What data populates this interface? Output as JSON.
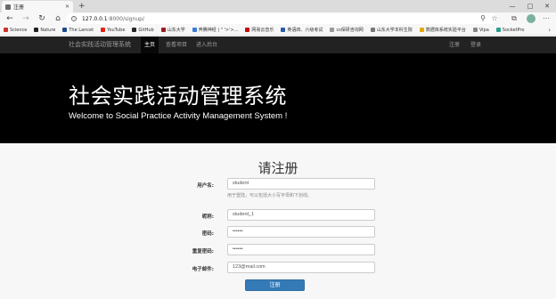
{
  "browser": {
    "tab_title": "注册",
    "tab_close": "✕",
    "new_tab": "+",
    "window_controls": {
      "minimize": "—",
      "maximize": "□",
      "close": "✕"
    },
    "nav_icons": {
      "back": "←",
      "forward": "→",
      "refresh": "↻",
      "home": "⌂"
    },
    "url": {
      "host": "127.0.0.1",
      "path": ":8000/signup/"
    },
    "toolbar_icons": {
      "extensions": "⚲",
      "favorite": "☆",
      "collections": "⧉",
      "more": "⋯"
    },
    "bookmarks": [
      {
        "label": "Science",
        "color": "#d0312d"
      },
      {
        "label": "Nature",
        "color": "#222222"
      },
      {
        "label": "The Lancet",
        "color": "#1a4a8a"
      },
      {
        "label": "YouTube",
        "color": "#e62117"
      },
      {
        "label": "GitHub",
        "color": "#24292e"
      },
      {
        "label": "山东大学",
        "color": "#9b1c20"
      },
      {
        "label": "奔腾神经 | \" '>'>...",
        "color": "#3a7bd5"
      },
      {
        "label": "网易云音乐",
        "color": "#c20c0c"
      },
      {
        "label": "英语四、六级考试",
        "color": "#2a5caa"
      },
      {
        "label": "cs保研咨询网",
        "color": "#999999"
      },
      {
        "label": "山东大学本科生院",
        "color": "#777777"
      },
      {
        "label": "数据库系统实验平台",
        "color": "#e0a800"
      },
      {
        "label": "Vipa",
        "color": "#888888"
      },
      {
        "label": "SocketPro",
        "color": "#2a9d8f"
      }
    ],
    "bookmarks_more": "›"
  },
  "site": {
    "brand": "社会实践活动管理系统",
    "nav": [
      {
        "label": "主页",
        "active": true
      },
      {
        "label": "查看项目",
        "active": false
      },
      {
        "label": "进入后台",
        "active": false
      }
    ],
    "nav_right": [
      "注册",
      "登录"
    ],
    "jumbotron": {
      "title": "社会实践活动管理系统",
      "subtitle": "Welcome to Social Practice Activity Management System !"
    },
    "form": {
      "title": "请注册",
      "fields": [
        {
          "label": "用户名:",
          "value": "student"
        },
        {
          "label": "昵称:",
          "value": "student_1"
        },
        {
          "label": "密码:",
          "value": "••••••"
        },
        {
          "label": "重复密码:",
          "value": "••••••"
        },
        {
          "label": "电子邮件:",
          "value": "123@mail.com"
        }
      ],
      "username_help": "用于登陆，可以包括大小写字母和下划线。",
      "submit_label": "注册"
    }
  }
}
